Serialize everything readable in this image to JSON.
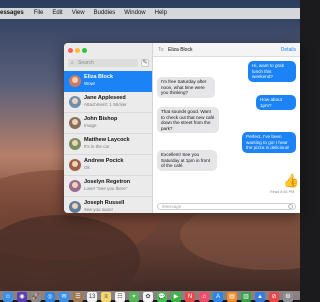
{
  "menubar": {
    "items": [
      "essages",
      "File",
      "Edit",
      "View",
      "Buddies",
      "Window",
      "Help"
    ]
  },
  "sidebar": {
    "search_placeholder": "Search",
    "conversations": [
      {
        "name": "Eliza Block",
        "preview": "Wow!",
        "avatar_color": "#c97b63"
      },
      {
        "name": "Jane Appleseed",
        "preview": "Attachment: 1 Sticker",
        "avatar_color": "#6d8fb3"
      },
      {
        "name": "John Bishop",
        "preview": "Image",
        "avatar_color": "#8a6e5a"
      },
      {
        "name": "Matthew Laycock",
        "preview": "It's in the car",
        "avatar_color": "#7a8f5e"
      },
      {
        "name": "Andrew Pocick",
        "preview": "Ok",
        "avatar_color": "#a05f4b"
      },
      {
        "name": "Joselyn Regetron",
        "preview": "Love! \"See you there\"",
        "avatar_color": "#9b6b8e"
      },
      {
        "name": "Joseph Russell",
        "preview": "See you soon!",
        "avatar_color": "#5f7a9b"
      }
    ]
  },
  "chat": {
    "to_label": "To:",
    "recipient": "Eliza Block",
    "details_label": "Details",
    "messages": [
      {
        "from": "me",
        "text": "Hi, want to grab lunch this weekend?"
      },
      {
        "from": "them",
        "text": "I'm free Saturday after noon, what time were you thinking?"
      },
      {
        "from": "me",
        "text": "How about 1pm?"
      },
      {
        "from": "them",
        "text": "That sounds good. Want to check out that new café down the street from the park?"
      },
      {
        "from": "me",
        "text": "Perfect, I've been wanting to go! I hear the pizza is delicious!"
      },
      {
        "from": "them",
        "text": "Excellent! See you Saturday at 1pm in front of the café."
      }
    ],
    "reaction_emoji": "👍",
    "read_receipt": "Read 5:45 PM",
    "input_placeholder": "iMessage"
  },
  "colors": {
    "accent": "#1b83f5",
    "bubble_received": "#e6e6e8"
  },
  "dock": {
    "icons": [
      {
        "name": "finder-icon",
        "color": "#3d8ee8",
        "glyph": "☺"
      },
      {
        "name": "siri-icon",
        "color": "#5a3fb0",
        "glyph": "◉"
      },
      {
        "name": "launchpad-icon",
        "color": "#8a8a8a",
        "glyph": "🚀"
      },
      {
        "name": "safari-icon",
        "color": "#2f86e0",
        "glyph": "◎"
      },
      {
        "name": "mail-icon",
        "color": "#3b8fe6",
        "glyph": "✉"
      },
      {
        "name": "contacts-icon",
        "color": "#a07a55",
        "glyph": "☰"
      },
      {
        "name": "calendar-icon",
        "color": "#f2f2f2",
        "glyph": "13"
      },
      {
        "name": "notes-icon",
        "color": "#f5d76e",
        "glyph": "≡"
      },
      {
        "name": "reminders-icon",
        "color": "#f4f4f4",
        "glyph": "☷"
      },
      {
        "name": "maps-icon",
        "color": "#5ab55a",
        "glyph": "⌖"
      },
      {
        "name": "photos-icon",
        "color": "#f4f4f4",
        "glyph": "✿"
      },
      {
        "name": "messages-icon",
        "color": "#43c44e",
        "glyph": "💬"
      },
      {
        "name": "facetime-icon",
        "color": "#3eb34a",
        "glyph": "▶"
      },
      {
        "name": "news-icon",
        "color": "#e84a4a",
        "glyph": "N"
      },
      {
        "name": "music-icon",
        "color": "#f04d6b",
        "glyph": "♫"
      },
      {
        "name": "appstore-icon",
        "color": "#2a86e8",
        "glyph": "A"
      },
      {
        "name": "books-icon",
        "color": "#f08d2e",
        "glyph": "▤"
      },
      {
        "name": "numbers-icon",
        "color": "#39a14a",
        "glyph": "▥"
      },
      {
        "name": "keynote-icon",
        "color": "#3a7be0",
        "glyph": "▲"
      },
      {
        "name": "news-app-icon",
        "color": "#e64848",
        "glyph": "⊘"
      },
      {
        "name": "system-preferences-icon",
        "color": "#8e8e93",
        "glyph": "⚙"
      }
    ]
  }
}
